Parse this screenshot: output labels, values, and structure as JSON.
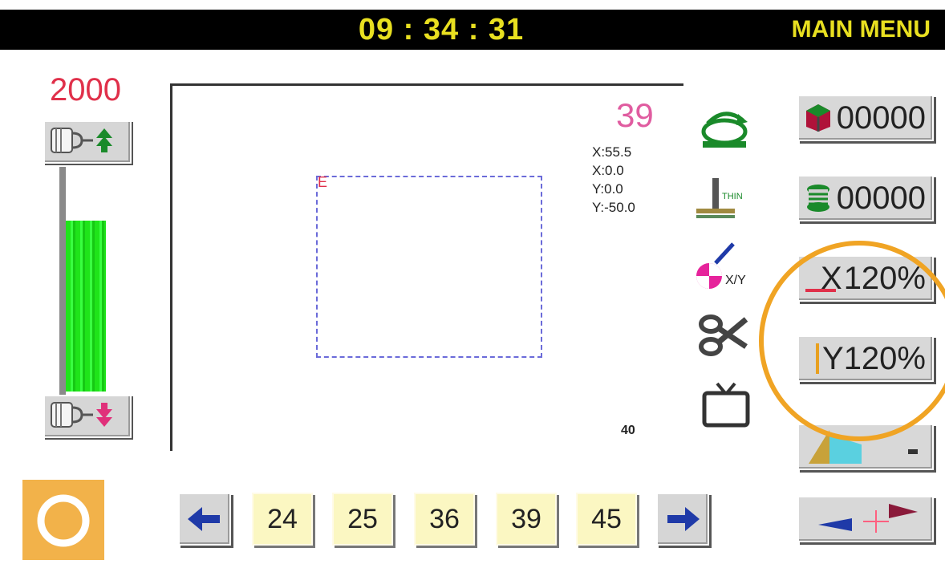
{
  "header": {
    "time": "09 : 34 : 31",
    "title": "MAIN MENU"
  },
  "speed": {
    "value": "2000",
    "level": 0.75
  },
  "canvas": {
    "pattern_number": "39",
    "coords": [
      "X:55.5",
      "X:0.0",
      "Y:0.0",
      "Y:-50.0"
    ],
    "stitch_count": "40",
    "start_marker": "E"
  },
  "tools": {
    "thin_label": "THIN",
    "xy_label": "X/Y"
  },
  "right": {
    "counter1": "00000",
    "counter2": "00000",
    "x_scale": "120%",
    "y_scale": "120%",
    "x_letter": "X",
    "y_letter": "Y"
  },
  "patterns": [
    "24",
    "25",
    "36",
    "39",
    "45"
  ],
  "colors": {
    "accent": "#e8df20",
    "highlight": "#f0a424",
    "pattern_button": "#fbf7c2",
    "speed_bar": "#1fe41a"
  }
}
